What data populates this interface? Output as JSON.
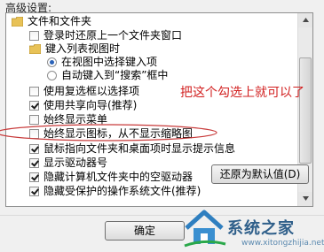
{
  "section_label": "高级设置:",
  "tree": {
    "items": [
      {
        "kind": "folder",
        "label": "文件和文件夹",
        "checked": false
      },
      {
        "kind": "check",
        "label": "登录时还原上一个文件夹窗口",
        "checked": false
      },
      {
        "kind": "folder",
        "label": "键入列表视图时",
        "checked": false
      },
      {
        "kind": "radio",
        "label": "在视图中选择键入项",
        "checked": true
      },
      {
        "kind": "radio",
        "label": "自动键入到“搜索”框中",
        "checked": false
      },
      {
        "kind": "check",
        "label": "使用复选框以选择项",
        "checked": false
      },
      {
        "kind": "check",
        "label": "使用共享向导(推荐)",
        "checked": true
      },
      {
        "kind": "check",
        "label": "始终显示菜单",
        "checked": false
      },
      {
        "kind": "check",
        "label": "始终显示图标，从不显示缩略图",
        "checked": false
      },
      {
        "kind": "check",
        "label": "鼠标指向文件夹和桌面项时显示提示信息",
        "checked": true
      },
      {
        "kind": "check",
        "label": "显示驱动器号",
        "checked": true
      },
      {
        "kind": "check",
        "label": "隐藏计算机文件夹中的空驱动器",
        "checked": true
      },
      {
        "kind": "check",
        "label": "隐藏受保护的操作系统文件(推荐)",
        "checked": true
      }
    ]
  },
  "annotation": "把这个勾选上就可以了",
  "restore_button": "还原为默认值(D)",
  "ok_button": "确定",
  "watermark": {
    "name": "系统之家",
    "url": "www.xitongzhijia.net"
  },
  "colors": {
    "annotation": "#d22020",
    "radio_dot": "#2a62b8",
    "watermark": "#2f5f8a"
  }
}
